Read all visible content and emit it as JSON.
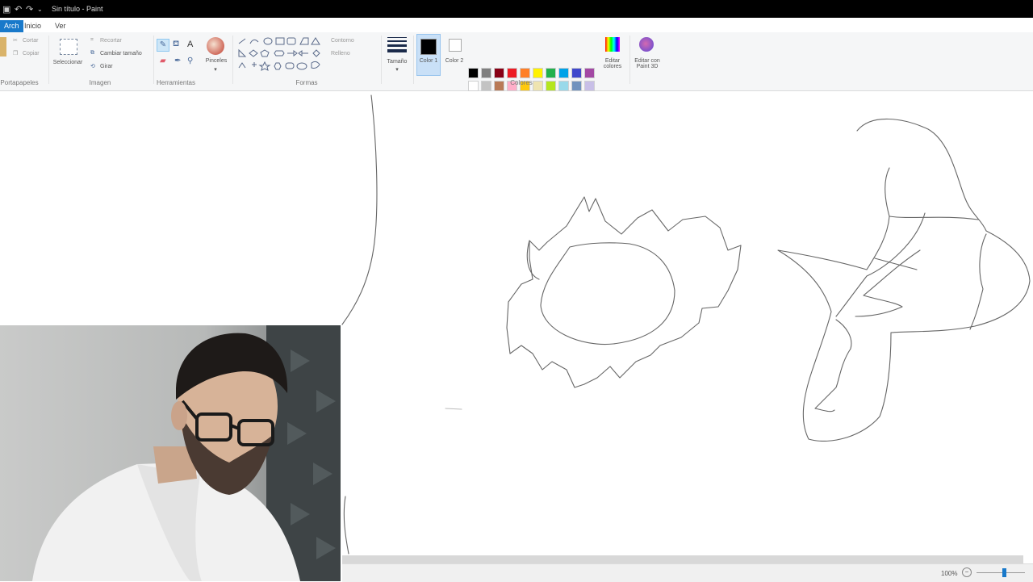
{
  "window": {
    "title": "Sin título - Paint",
    "quick_access": [
      "save-icon",
      "undo-icon",
      "redo-icon",
      "customize-icon"
    ]
  },
  "tabs": [
    {
      "label": "Arch"
    },
    {
      "label": "Inicio"
    },
    {
      "label": "Ver"
    }
  ],
  "ribbon": {
    "clipboard": {
      "cut": "Cortar",
      "copy": "Copiar",
      "group": "Portapapeles"
    },
    "image": {
      "select": "Seleccionar",
      "crop": "Recortar",
      "resize": "Cambiar tamaño",
      "rotate": "Girar",
      "group": "Imagen"
    },
    "tools": {
      "group": "Herramientas",
      "text_glyph": "A"
    },
    "brushes": {
      "label": "Pinceles"
    },
    "shapes": {
      "outline": "Contorno",
      "fill": "Relleno",
      "group": "Formas"
    },
    "size": {
      "label": "Tamaño"
    },
    "colors": {
      "color1_label": "Color 1",
      "color2_label": "Color 2",
      "edit_colors": "Editar colores",
      "group": "Colores",
      "color1_value": "#000000",
      "color2_value": "#ffffff",
      "palette": [
        "#000000",
        "#7f7f7f",
        "#880015",
        "#ed1c24",
        "#ff7f27",
        "#fff200",
        "#22b14c",
        "#00a2e8",
        "#3f48cc",
        "#a349a4",
        "#ffffff",
        "#c3c3c3",
        "#b97a57",
        "#ffaec9",
        "#ffc90e",
        "#efe4b0",
        "#b5e61d",
        "#99d9ea",
        "#7092be",
        "#c8bfe7",
        "#ffffff",
        "#ffffff",
        "#ffffff",
        "#ffffff",
        "#ffffff",
        "#ffffff",
        "#ffffff",
        "#ffffff",
        "#ffffff",
        "#ffffff"
      ]
    },
    "paint3d": {
      "label": "Editar con Paint 3D"
    }
  },
  "status": {
    "zoom": "100%"
  }
}
